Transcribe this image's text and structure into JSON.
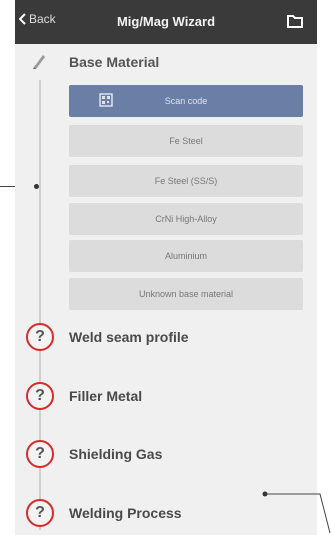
{
  "header": {
    "back_label": "Back",
    "title": "Mig/Mag Wizard"
  },
  "base_material": {
    "title": "Base Material",
    "options": [
      "Scan code",
      "Fe Steel",
      "Fe Steel (SS/S)",
      "CrNi High-Alloy",
      "Aluminium",
      "Unknown base material"
    ]
  },
  "steps": [
    {
      "icon": "?",
      "label": "Weld seam profile"
    },
    {
      "icon": "?",
      "label": "Filler Metal"
    },
    {
      "icon": "?",
      "label": "Shielding Gas"
    },
    {
      "icon": "?",
      "label": "Welding Process"
    }
  ],
  "colors": {
    "header_bg": "#3a3a3a",
    "primary_option": "#6b7fa6",
    "question_ring": "#d62b2b",
    "panel_bg": "#f0f0f0"
  }
}
